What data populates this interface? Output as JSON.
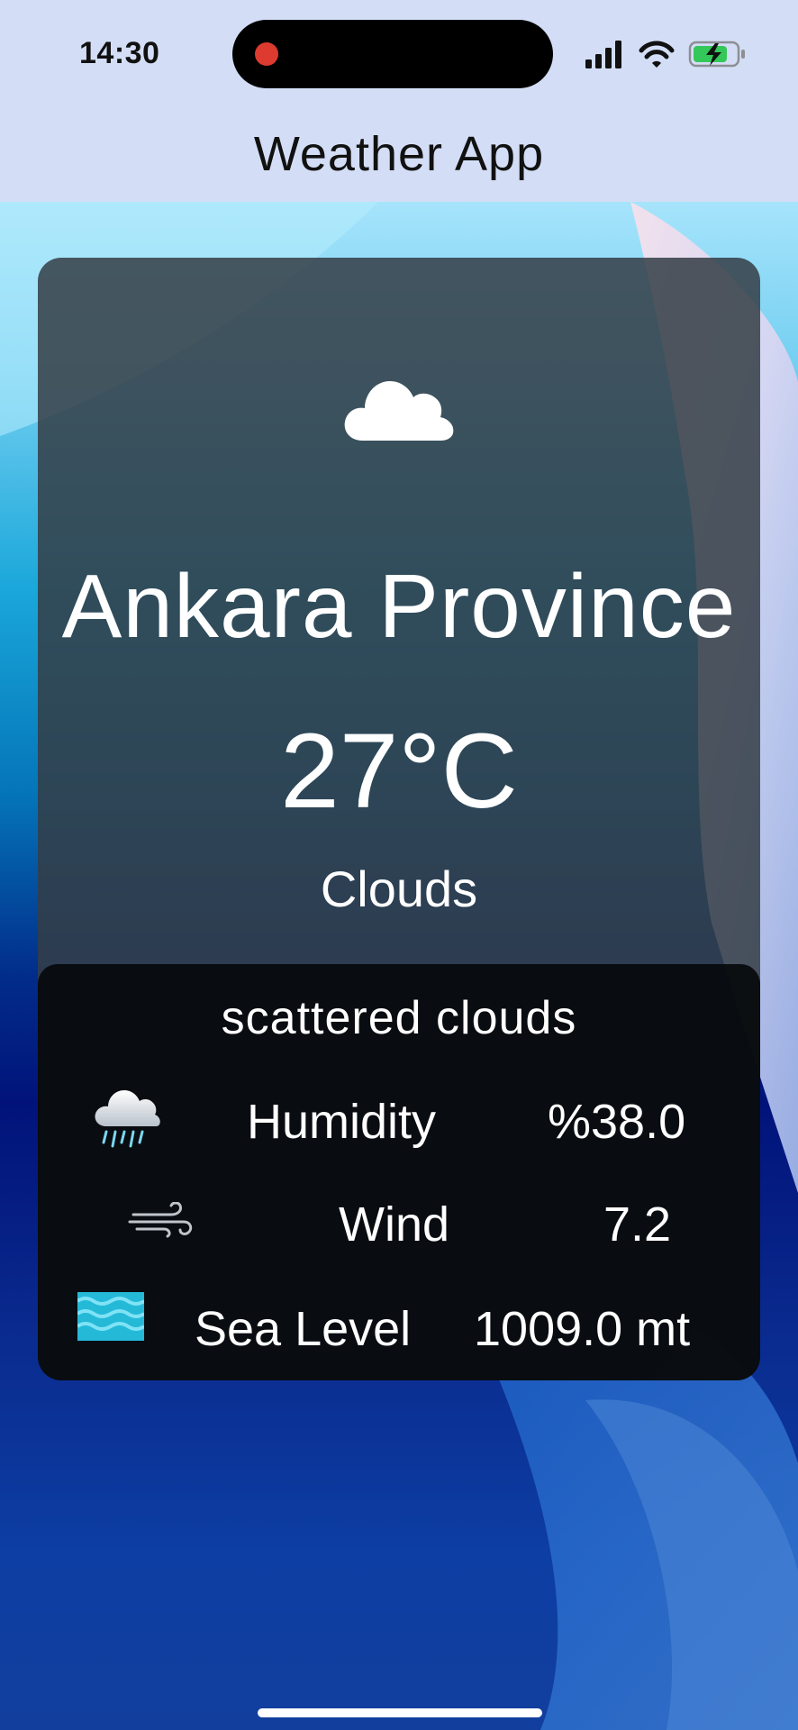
{
  "status_bar": {
    "time": "14:30",
    "icons": [
      "signal-icon",
      "wifi-icon",
      "battery-charging-icon"
    ]
  },
  "app_bar": {
    "title": "Weather App"
  },
  "weather": {
    "icon": "cloud-icon",
    "city": "Ankara Province",
    "temperature": "27°C",
    "condition": "Clouds"
  },
  "details": {
    "description": "scattered clouds",
    "rows": [
      {
        "icon": "rain-cloud-icon",
        "label": "Humidity",
        "value": "%38.0"
      },
      {
        "icon": "wind-icon",
        "label": "Wind",
        "value": "7.2"
      },
      {
        "icon": "water-waves-icon",
        "label": "Sea Level",
        "value": "1009.0 mt"
      }
    ]
  },
  "colors": {
    "topbar_bg": "#d3def6",
    "card_bg": "#343e46",
    "details_bg": "#06080a",
    "text_light": "#ffffff",
    "camera_red": "#dd3b2f",
    "battery_green": "#34c759",
    "sea_cyan": "#25b9d8"
  }
}
